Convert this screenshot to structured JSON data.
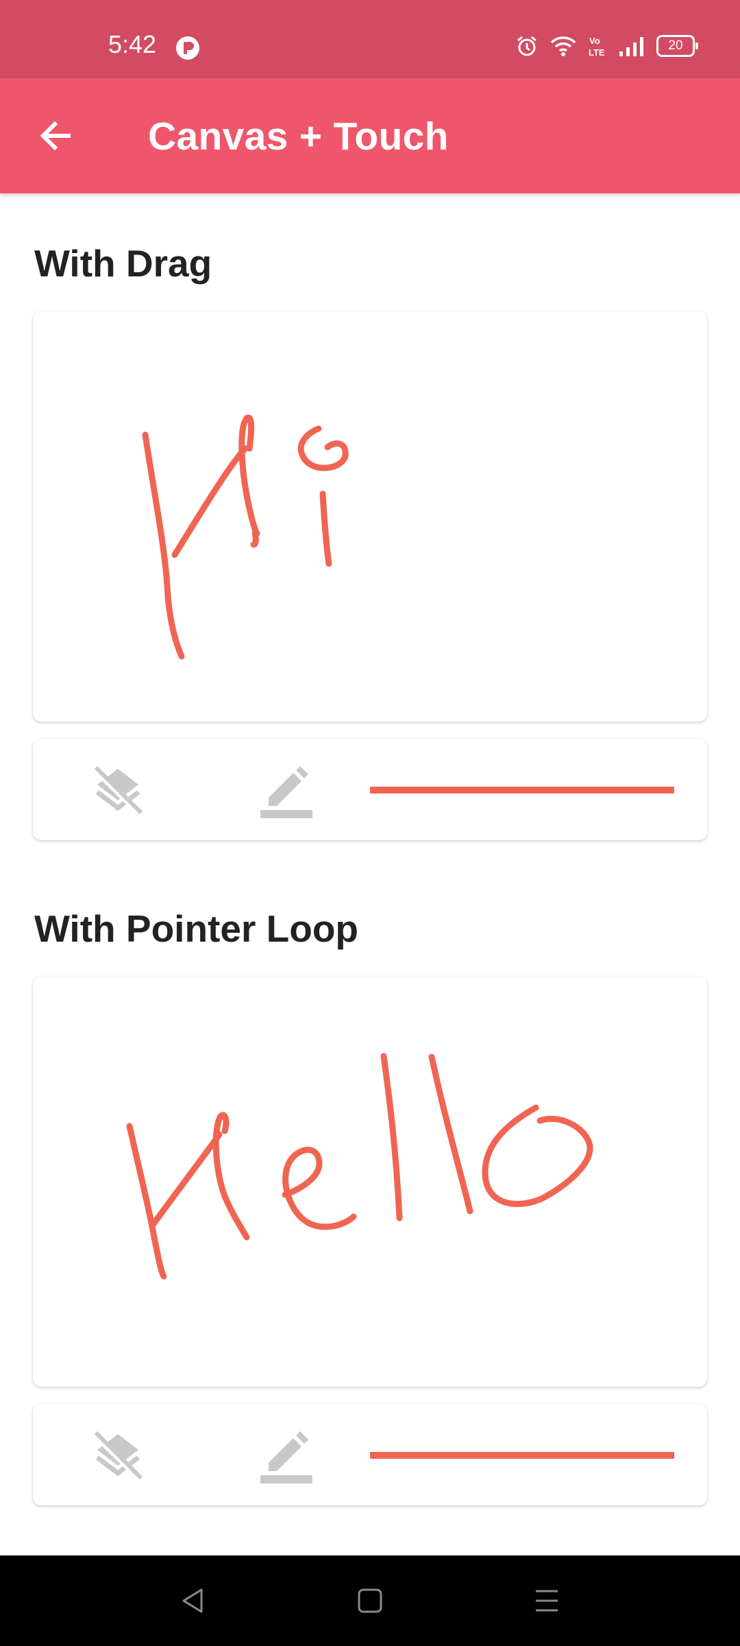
{
  "status": {
    "time": "5:42",
    "battery": "20",
    "icons": [
      "app-notification-icon",
      "alarm-icon",
      "wifi-icon",
      "volte-icon",
      "signal-icon",
      "battery-icon"
    ]
  },
  "app_bar": {
    "title": "Canvas + Touch",
    "back_icon": "arrow-left-icon",
    "color": "#f0566b"
  },
  "sections": [
    {
      "title": "With Drag",
      "drawing": "Hi",
      "toolbar": {
        "clear_icon": "layers-clear-icon",
        "pen_icon": "edit-pen-icon",
        "stroke_color": "#f06552"
      }
    },
    {
      "title": "With Pointer Loop",
      "drawing": "Hello",
      "toolbar": {
        "clear_icon": "layers-clear-icon",
        "pen_icon": "edit-pen-icon",
        "stroke_color": "#f06552"
      }
    }
  ],
  "nav": {
    "icons": [
      "back-triangle-icon",
      "home-square-icon",
      "recents-menu-icon"
    ]
  },
  "colors": {
    "status_bar": "#d24b62",
    "ink": "#f06552",
    "icon_gray": "#c8c8c8"
  }
}
